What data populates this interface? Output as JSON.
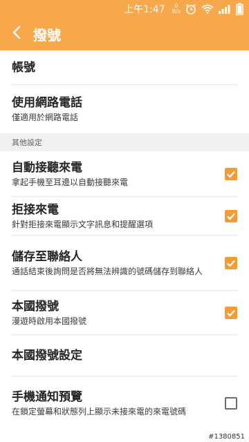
{
  "status_bar": {
    "time": "上午1:47",
    "net_speed_value": "0",
    "net_speed_unit": "B/s",
    "icons": [
      "alarm-icon",
      "wifi-icon",
      "signal-icon",
      "battery-icon"
    ],
    "background": "#f6a84a"
  },
  "app_bar": {
    "back_icon": "chevron-left-icon",
    "title": "撥號",
    "color": "#f6a84a"
  },
  "settings": {
    "account": {
      "title": "帳號"
    },
    "internet_call": {
      "title": "使用網路電話",
      "summary": "僅適用於網路電話"
    },
    "section_other": "其他設定",
    "auto_answer": {
      "title": "自動接聽來電",
      "summary": "拿起手機至耳邊以自動接聽來電",
      "checked": true
    },
    "reject_call": {
      "title": "拒接來電",
      "summary": "針對拒接來電顯示文字訊息和提醒選項",
      "checked": true
    },
    "save_contact": {
      "title": "儲存至聯絡人",
      "summary": "通話結束後詢問是否將無法辨識的號碼儲存到聯絡人",
      "checked": true
    },
    "home_dial": {
      "title": "本國撥號",
      "summary": "漫遊時啟用本國撥號",
      "checked": true
    },
    "home_dial_settings": {
      "title": "本國撥號設定"
    },
    "notification_preview": {
      "title": "手機通知預覽",
      "summary": "在鎖定螢幕和狀態列上顯示未接來電的來電號碼",
      "checked": false
    }
  },
  "watermark": "#1380851",
  "accent_color": "#f39c36"
}
